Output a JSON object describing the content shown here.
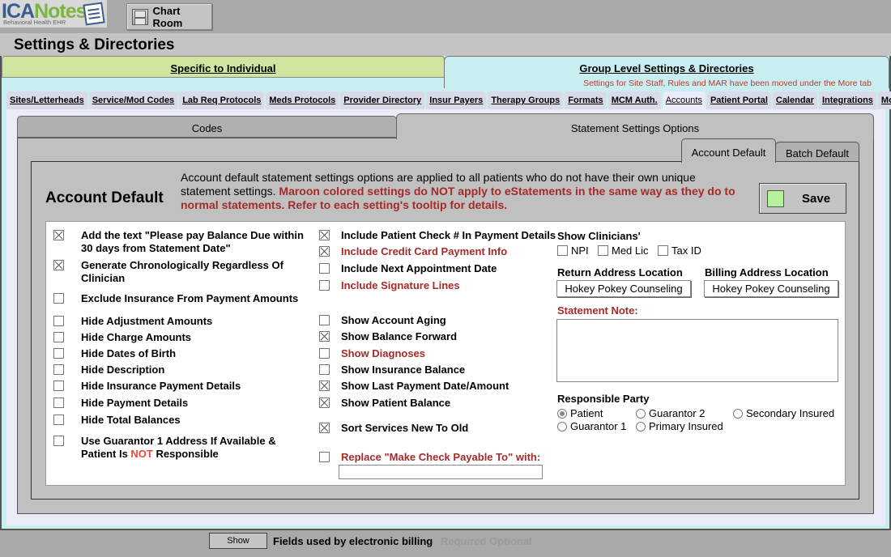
{
  "app": {
    "logo_main_a": "ICA",
    "logo_main_b": "Notes",
    "logo_sub": "Behavioral Health EHR",
    "chart_room_label": "Chart Room"
  },
  "page_title": "Settings & Directories",
  "main_tabs": {
    "individual": "Specific to Individual",
    "group": "Group Level Settings & Directories",
    "group_note": "Settings for Site Staff, Rules and MAR have been moved under the More tab"
  },
  "sub_tabs": [
    {
      "label": "Sites/Letterheads",
      "active": false
    },
    {
      "label": "Service/Mod Codes",
      "active": false
    },
    {
      "label": "Lab Req Protocols",
      "active": false
    },
    {
      "label": "Meds Protocols",
      "active": false
    },
    {
      "label": "Provider Directory",
      "active": false
    },
    {
      "label": "Insur Payers",
      "active": false
    },
    {
      "label": "Therapy Groups",
      "active": false
    },
    {
      "label": "Formats",
      "active": false
    },
    {
      "label": "MCM Auth.",
      "active": false
    },
    {
      "label": "Accounts",
      "active": true
    },
    {
      "label": "Patient Portal",
      "active": false
    },
    {
      "label": "Calendar",
      "active": false
    },
    {
      "label": "Integrations",
      "active": false
    },
    {
      "label": "More",
      "active": false
    }
  ],
  "inner_tabs": {
    "codes": "Codes",
    "statement": "Statement Settings Options"
  },
  "default_tabs": {
    "account": "Account Default",
    "batch": "Batch Default"
  },
  "account_default": {
    "title": "Account Default",
    "desc_plain": "Account default statement settings options are applied to all patients who do not have their own unique statement settings. ",
    "desc_warn": "Maroon colored settings do NOT apply to eStatements in the same way as they do to normal statements. Refer to each setting's tooltip for details.",
    "save_label": "Save"
  },
  "left_options": [
    {
      "label": "Add the text \"Please pay Balance Due within 30 days from Statement Date\"",
      "checked": true
    },
    {
      "label": "Generate Chronologically Regardless Of Clinician",
      "checked": true
    },
    {
      "label": "Exclude Insurance From Payment Amounts",
      "checked": false
    },
    {
      "label": "Hide Adjustment Amounts",
      "checked": false
    },
    {
      "label": "Hide Charge Amounts",
      "checked": false
    },
    {
      "label": "Hide Dates of Birth",
      "checked": false
    },
    {
      "label": "Hide Description",
      "checked": false
    },
    {
      "label": "Hide Insurance Payment Details",
      "checked": false
    },
    {
      "label": "Hide Payment Details",
      "checked": false
    },
    {
      "label": "Hide Total Balances",
      "checked": false
    }
  ],
  "guarantor_option": {
    "label_a": "Use Guarantor 1 Address If Available & Patient Is ",
    "label_not": "NOT",
    "label_b": " Responsible",
    "checked": false
  },
  "middle_options": [
    {
      "label": "Include Patient Check # In Payment Details",
      "checked": true,
      "maroon": false
    },
    {
      "label": "Include Credit Card Payment Info",
      "checked": true,
      "maroon": true
    },
    {
      "label": "Include Next Appointment Date",
      "checked": false,
      "maroon": false
    },
    {
      "label": "Include Signature Lines",
      "checked": false,
      "maroon": true
    },
    {
      "label": "Show Account Aging",
      "checked": false,
      "maroon": false
    },
    {
      "label": "Show Balance Forward",
      "checked": true,
      "maroon": false
    },
    {
      "label": "Show Diagnoses",
      "checked": false,
      "maroon": true
    },
    {
      "label": "Show Insurance Balance",
      "checked": false,
      "maroon": false
    },
    {
      "label": "Show Last Payment Date/Amount",
      "checked": true,
      "maroon": false
    },
    {
      "label": "Show Patient Balance",
      "checked": true,
      "maroon": false
    },
    {
      "label": "Sort Services New To Old",
      "checked": true,
      "maroon": false
    },
    {
      "label": "Replace \"Make Check Payable To\" with:",
      "checked": false,
      "maroon": true
    }
  ],
  "replace_value": "",
  "right": {
    "show_clinicians_label": "Show Clinicians'",
    "clinician_options": [
      {
        "label": "NPI",
        "checked": false
      },
      {
        "label": "Med Lic",
        "checked": false
      },
      {
        "label": "Tax ID",
        "checked": false
      }
    ],
    "return_address_label": "Return Address Location",
    "return_address_value": "Hokey Pokey Counseling",
    "billing_address_label": "Billing Address Location",
    "billing_address_value": "Hokey Pokey Counseling",
    "statement_note_label": "Statement Note:",
    "statement_note_value": "",
    "responsible_party_label": "Responsible Party",
    "responsible_party_options": [
      {
        "label": "Patient",
        "selected": true
      },
      {
        "label": "Guarantor 2",
        "selected": false
      },
      {
        "label": "Secondary Insured",
        "selected": false
      },
      {
        "label": "Guarantor 1",
        "selected": false
      },
      {
        "label": "Primary Insured",
        "selected": false
      }
    ]
  },
  "footer": {
    "show_label": "Show",
    "fields_label": "Fields used by electronic billing",
    "legend_required": "Required",
    "legend_optional": "Optional"
  },
  "colors": {
    "maroon": "#a52a2a",
    "save_indicator": "#b6f29a",
    "individual_tab": "#cfe5a0",
    "group_tab": "#c8eef2"
  }
}
